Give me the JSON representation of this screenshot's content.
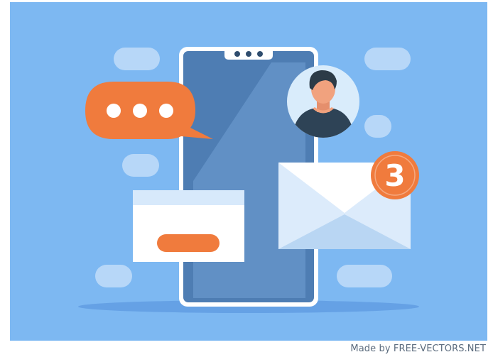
{
  "illustration": {
    "notification_count": "3",
    "colors": {
      "background": "#7db8f2",
      "phone_body": "#4e7db3",
      "phone_frame": "#ffffff",
      "accent_orange": "#f07b3d",
      "bubble_light": "#b7d7f8",
      "envelope": "#dcebfb",
      "avatar_circle": "#d9ecfb",
      "avatar_shirt": "#2e4356",
      "avatar_skin": "#f1a27e",
      "avatar_hair": "#2c3b47"
    }
  },
  "credit": {
    "text": "Made by FREE-VECTORS.NET"
  }
}
